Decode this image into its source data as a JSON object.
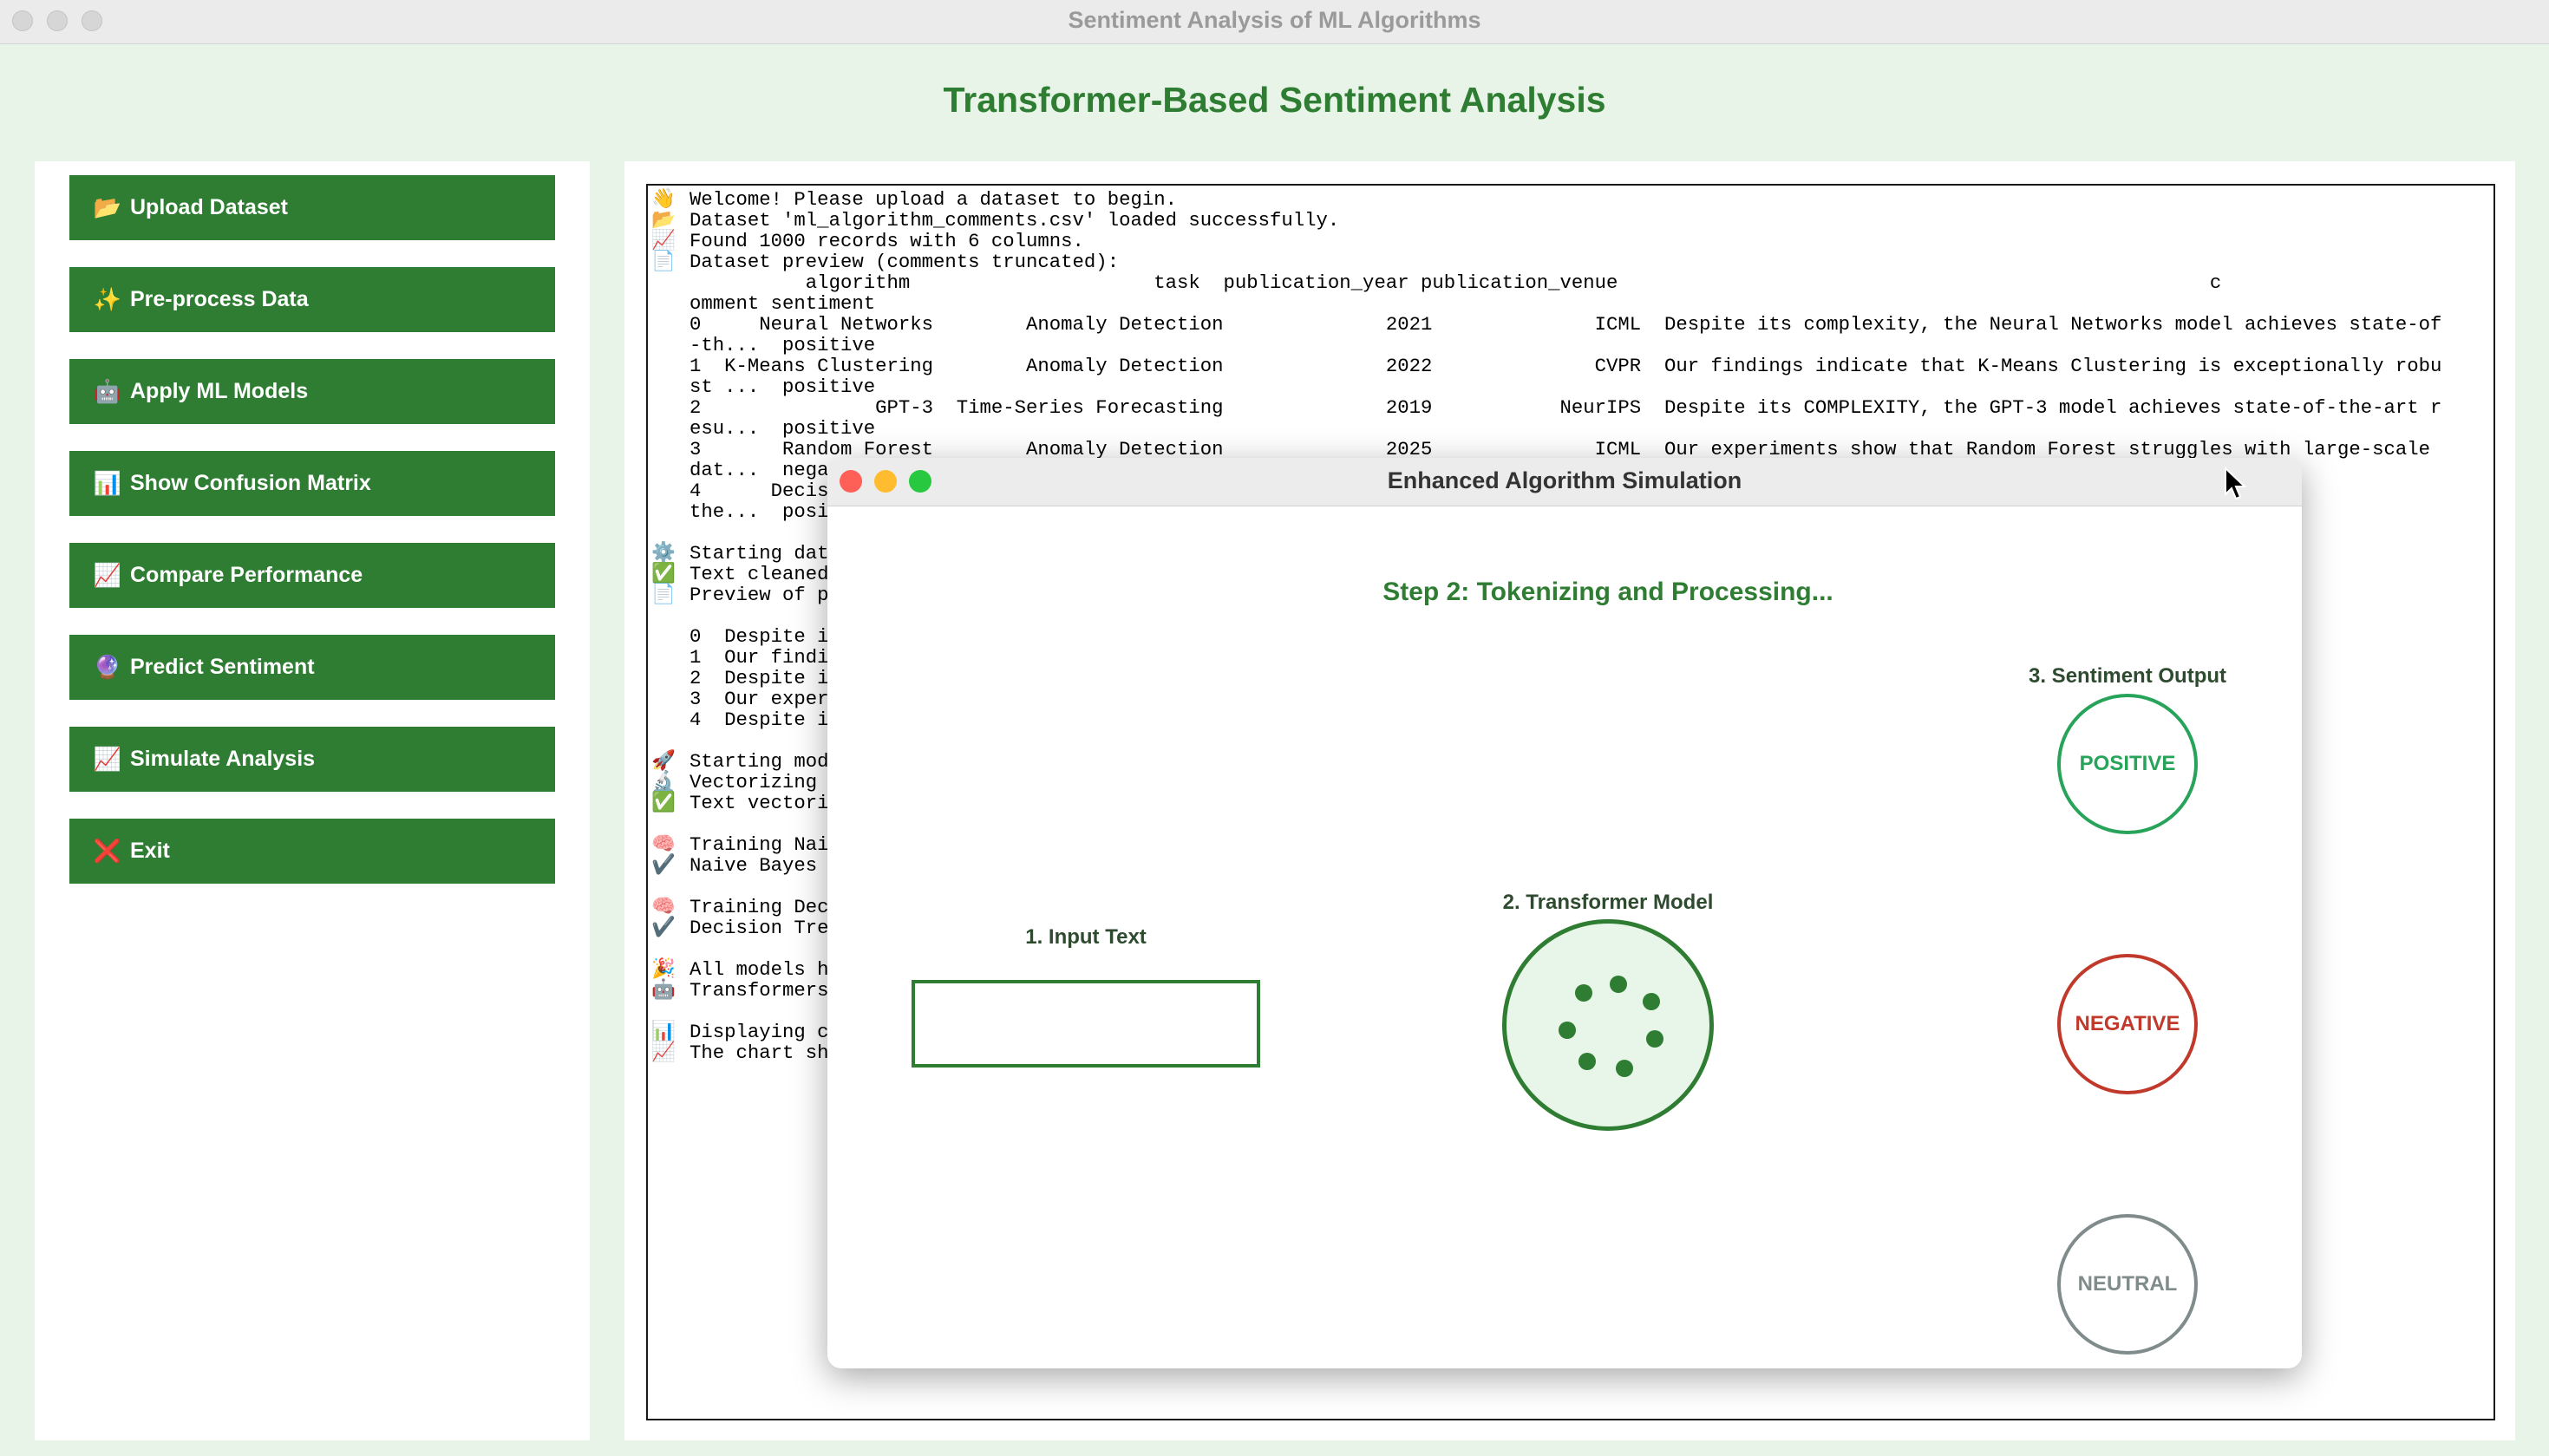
{
  "window": {
    "title": "Sentiment Analysis of ML Algorithms"
  },
  "app": {
    "heading": "Transformer-Based Sentiment Analysis"
  },
  "sidebar": {
    "buttons": [
      {
        "icon": "📂",
        "label": "Upload Dataset"
      },
      {
        "icon": "✨",
        "label": "Pre-process Data"
      },
      {
        "icon": "🤖",
        "label": "Apply ML Models"
      },
      {
        "icon": "📊",
        "label": "Show Confusion Matrix"
      },
      {
        "icon": "📈",
        "label": "Compare Performance"
      },
      {
        "icon": "🔮",
        "label": "Predict Sentiment"
      },
      {
        "icon": "📈",
        "label": "Simulate Analysis"
      },
      {
        "icon": "❌",
        "label": "Exit"
      }
    ]
  },
  "console": {
    "lines": [
      {
        "icon": "👋",
        "text": "Welcome! Please upload a dataset to begin."
      },
      {
        "icon": "📂",
        "text": "Dataset 'ml_algorithm_comments.csv' loaded successfully."
      },
      {
        "icon": "📈",
        "text": "Found 1000 records with 6 columns."
      },
      {
        "icon": "📄",
        "text": "Dataset preview (comments truncated):"
      },
      {
        "icon": "",
        "text": "          algorithm                     task  publication_year publication_venue                                                   c"
      },
      {
        "icon": "",
        "text": "omment sentiment"
      },
      {
        "icon": "",
        "text": "0     Neural Networks        Anomaly Detection              2021              ICML  Despite its complexity, the Neural Networks model achieves state-of"
      },
      {
        "icon": "",
        "text": "-th...  positive"
      },
      {
        "icon": "",
        "text": "1  K-Means Clustering        Anomaly Detection              2022              CVPR  Our findings indicate that K-Means Clustering is exceptionally robu"
      },
      {
        "icon": "",
        "text": "st ...  positive"
      },
      {
        "icon": "",
        "text": "2               GPT-3  Time-Series Forecasting              2019           NeurIPS  Despite its COMPLEXITY, the GPT-3 model achieves state-of-the-art r"
      },
      {
        "icon": "",
        "text": "esu...  positive"
      },
      {
        "icon": "",
        "text": "3       Random Forest        Anomaly Detection              2025              ICML  Our experiments show that Random Forest struggles with large-scale"
      },
      {
        "icon": "",
        "text": "dat...  negative"
      },
      {
        "icon": "",
        "text": "4      Decision Tree                                                                                                   ieves state-of-"
      },
      {
        "icon": "",
        "text": "the...  positive"
      },
      {
        "icon": "",
        "text": ""
      },
      {
        "icon": "⚙️",
        "text": "Starting data"
      },
      {
        "icon": "✅",
        "text": "Text cleaned"
      },
      {
        "icon": "📄",
        "text": "Preview of p"
      },
      {
        "icon": "",
        "text": ""
      },
      {
        "icon": "",
        "text": "0  Despite its"
      },
      {
        "icon": "",
        "text": "1  Our findings"
      },
      {
        "icon": "",
        "text": "2  Despite its"
      },
      {
        "icon": "",
        "text": "3  Our experime"
      },
      {
        "icon": "",
        "text": "4  Despite its"
      },
      {
        "icon": "",
        "text": ""
      },
      {
        "icon": "🚀",
        "text": "Starting mod"
      },
      {
        "icon": "🔬",
        "text": "Vectorizing"
      },
      {
        "icon": "✅",
        "text": "Text vectori"
      },
      {
        "icon": "",
        "text": ""
      },
      {
        "icon": "🧠",
        "text": "Training Nai"
      },
      {
        "icon": "✔️",
        "text": "Naive Bayes"
      },
      {
        "icon": "",
        "text": ""
      },
      {
        "icon": "🧠",
        "text": "Training Dec"
      },
      {
        "icon": "✔️",
        "text": "Decision Tre"
      },
      {
        "icon": "",
        "text": ""
      },
      {
        "icon": "🎉",
        "text": "All models h"
      },
      {
        "icon": "🤖",
        "text": "Transformers"
      },
      {
        "icon": "",
        "text": ""
      },
      {
        "icon": "📊",
        "text": "Displaying c"
      },
      {
        "icon": "📈",
        "text": "The chart sh"
      }
    ]
  },
  "dialog": {
    "title": "Enhanced Algorithm Simulation",
    "step": "Step 2: Tokenizing and Processing...",
    "input_label": "1. Input Text",
    "input_value": "",
    "model_label": "2. Transformer Model",
    "output_label": "3. Sentiment Output",
    "outputs": {
      "positive": "POSITIVE",
      "negative": "NEGATIVE",
      "neutral": "NEUTRAL"
    },
    "colors": {
      "positive": "#27a35a",
      "negative": "#c0392b",
      "neutral": "#808b8c",
      "accent": "#2e7d32"
    }
  }
}
